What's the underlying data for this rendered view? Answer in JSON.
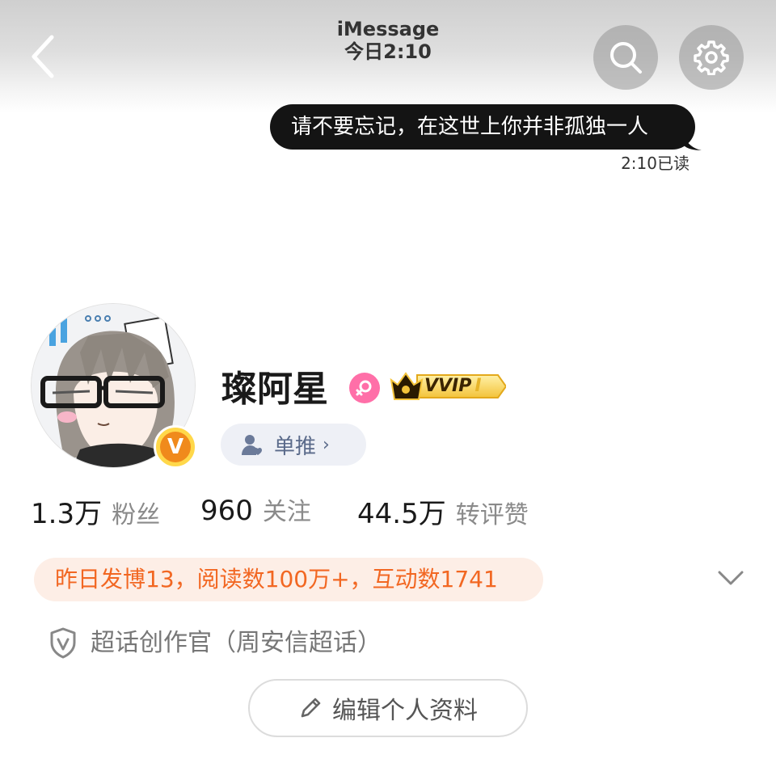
{
  "header": {
    "title": "iMessage",
    "subtitle": "今日2:10",
    "back_icon": "chevron-left-icon",
    "search_icon": "search-icon",
    "settings_icon": "gear-icon"
  },
  "message": {
    "text": "请不要忘记，在这世上你并非孤独一人",
    "status": "2:10已读"
  },
  "profile": {
    "name": "璨阿星",
    "verified_badge": "V",
    "vip_label": "VVIP",
    "vip_level": "I",
    "tag_label": "单推",
    "tag_arrow": "›"
  },
  "stats": [
    {
      "value": "1.3万",
      "label": "粉丝"
    },
    {
      "value": "960",
      "label": "关注"
    },
    {
      "value": "44.5万",
      "label": "转评赞"
    }
  ],
  "notice": "昨日发博13，阅读数100万+，互动数1741",
  "supertopic": "超话创作官（周安信超话）",
  "edit_button": "编辑个人资料",
  "colors": {
    "accent_orange": "#f26722",
    "notice_bg": "#fdeee6",
    "bubble_bg": "#141414",
    "female_pink": "#ff6fa8",
    "vip_gold": "#f5c542"
  }
}
